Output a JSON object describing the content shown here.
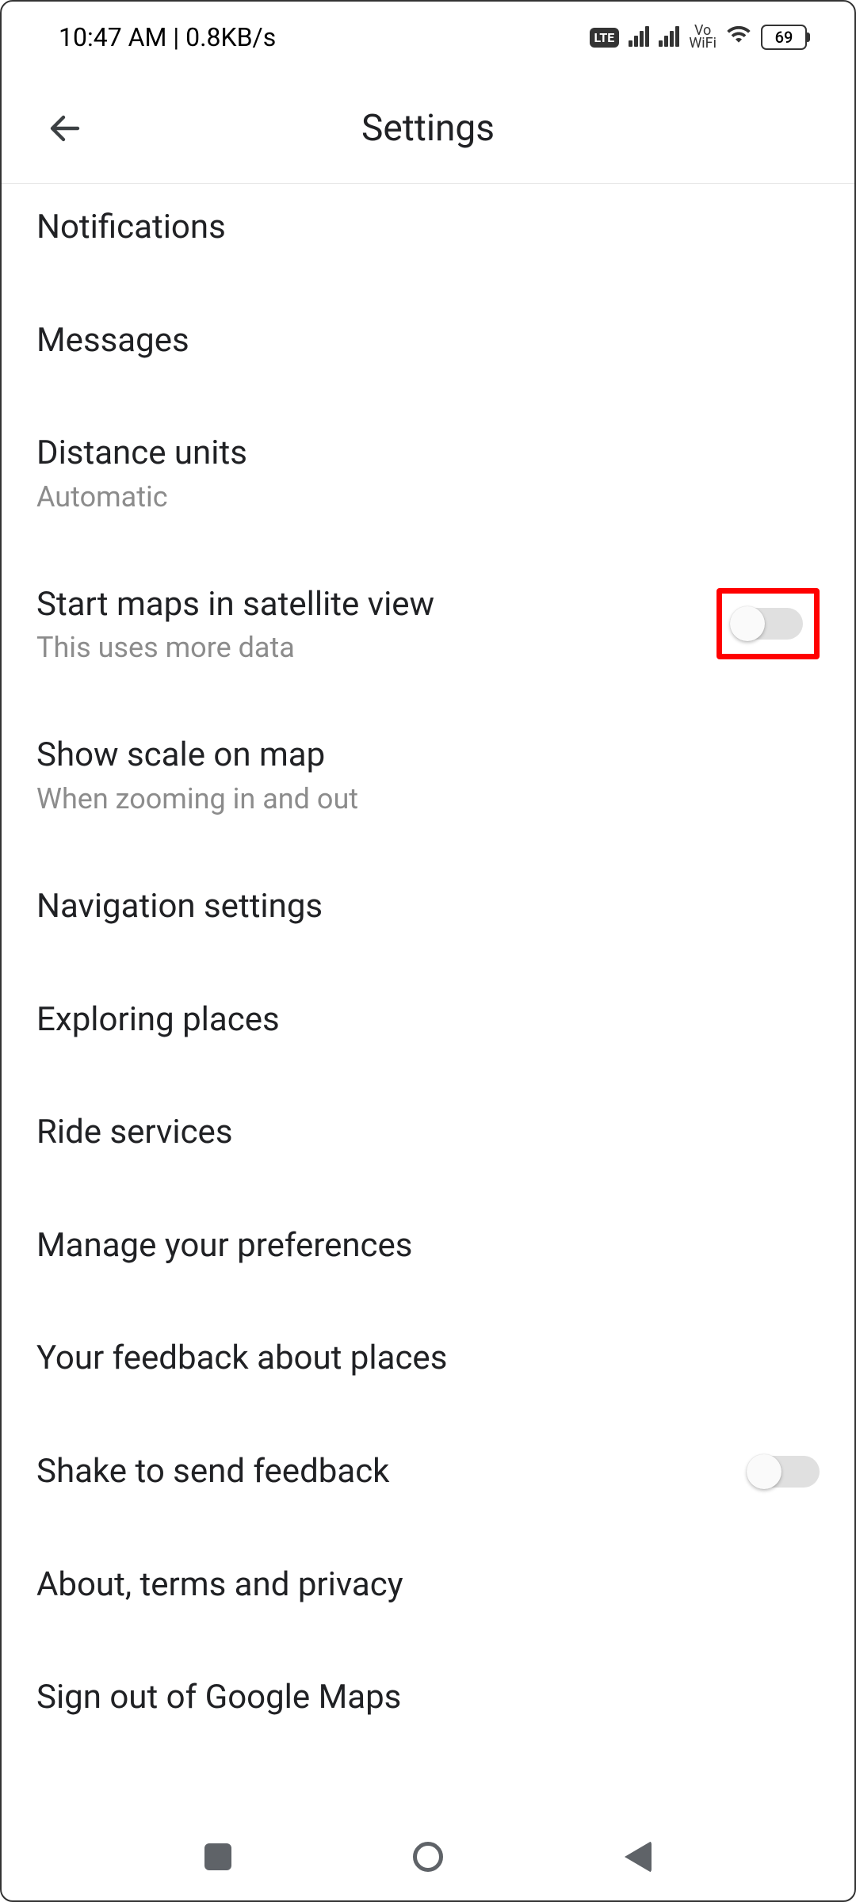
{
  "statusBar": {
    "time": "10:47 AM",
    "speed": "0.8KB/s",
    "lte": "LTE",
    "voWifi": "Vo\nWiFi",
    "battery": "69"
  },
  "appBar": {
    "title": "Settings"
  },
  "settings": {
    "items": [
      {
        "title": "Notifications",
        "subtitle": "",
        "hasToggle": false,
        "highlighted": false
      },
      {
        "title": "Messages",
        "subtitle": "",
        "hasToggle": false,
        "highlighted": false
      },
      {
        "title": "Distance units",
        "subtitle": "Automatic",
        "hasToggle": false,
        "highlighted": false
      },
      {
        "title": "Start maps in satellite view",
        "subtitle": "This uses more data",
        "hasToggle": true,
        "toggleOn": false,
        "highlighted": true
      },
      {
        "title": "Show scale on map",
        "subtitle": "When zooming in and out",
        "hasToggle": false,
        "highlighted": false
      },
      {
        "title": "Navigation settings",
        "subtitle": "",
        "hasToggle": false,
        "highlighted": false
      },
      {
        "title": "Exploring places",
        "subtitle": "",
        "hasToggle": false,
        "highlighted": false
      },
      {
        "title": "Ride services",
        "subtitle": "",
        "hasToggle": false,
        "highlighted": false
      },
      {
        "title": "Manage your preferences",
        "subtitle": "",
        "hasToggle": false,
        "highlighted": false
      },
      {
        "title": "Your feedback about places",
        "subtitle": "",
        "hasToggle": false,
        "highlighted": false
      },
      {
        "title": "Shake to send feedback",
        "subtitle": "",
        "hasToggle": true,
        "toggleOn": false,
        "highlighted": false
      },
      {
        "title": "About, terms and privacy",
        "subtitle": "",
        "hasToggle": false,
        "highlighted": false
      },
      {
        "title": "Sign out of Google Maps",
        "subtitle": "",
        "hasToggle": false,
        "highlighted": false
      }
    ]
  }
}
